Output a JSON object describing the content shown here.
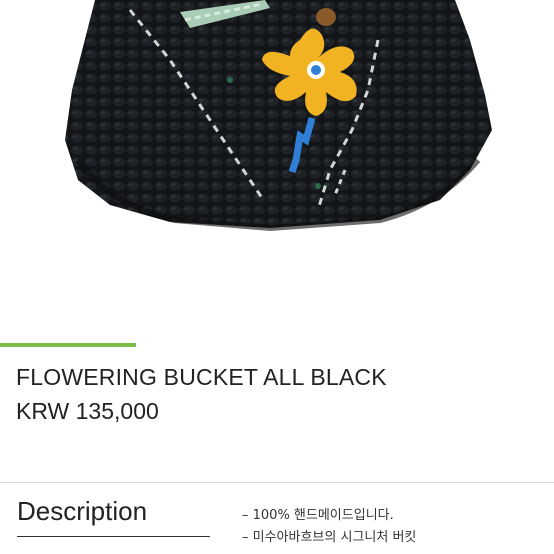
{
  "product": {
    "name": "FLOWERING BUCKET ALL BLACK",
    "price": "KRW 135,000"
  },
  "description": {
    "heading": "Description",
    "items": [
      "– 100% 핸드메이드입니다.",
      "– 미수아바흐브의 시그니처 버킷"
    ]
  },
  "colors": {
    "accent": "#7bbf4a",
    "hat": "#111315",
    "flower": "#f2b322",
    "stem": "#2f7fd6"
  },
  "icons": {
    "product_image": "knit-bucket-hat-photo"
  }
}
